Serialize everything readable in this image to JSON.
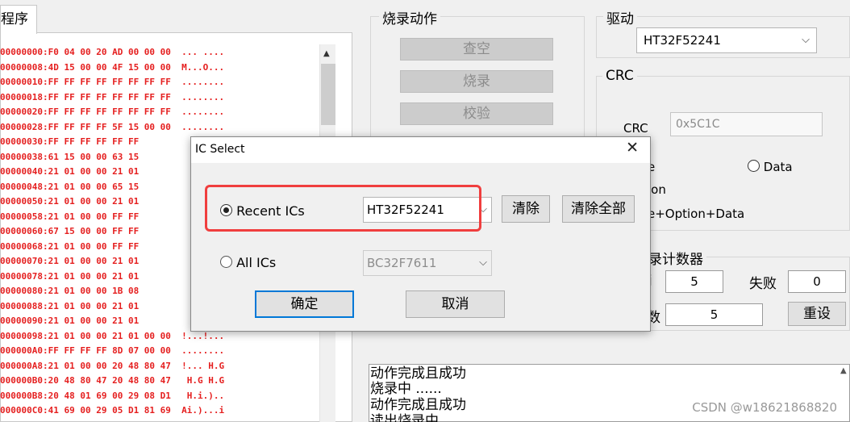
{
  "left_panel": {
    "tab_label": "程序",
    "hex_lines": [
      "00000000:F0 04 00 20 AD 00 00 00  ... ....",
      "00000008:4D 15 00 00 4F 15 00 00  M...O...",
      "00000010:FF FF FF FF FF FF FF FF  ........",
      "00000018:FF FF FF FF FF FF FF FF  ........",
      "00000020:FF FF FF FF FF FF FF FF  ........",
      "00000028:FF FF FF FF 5F 15 00 00  ........",
      "00000030:FF FF FF FF FF FF",
      "00000038:61 15 00 00 63 15",
      "00000040:21 01 00 00 21 01",
      "00000048:21 01 00 00 65 15",
      "00000050:21 01 00 00 21 01",
      "00000058:21 01 00 00 FF FF",
      "00000060:67 15 00 00 FF FF",
      "00000068:21 01 00 00 FF FF",
      "00000070:21 01 00 00 21 01",
      "00000078:21 01 00 00 21 01",
      "00000080:21 01 00 00 1B 08",
      "00000088:21 01 00 00 21 01",
      "00000090:21 01 00 00 21 01",
      "00000098:21 01 00 00 21 01 00 00  !...!...",
      "000000A0:FF FF FF FF 8D 07 00 00  ........",
      "000000A8:21 01 00 00 20 48 80 47  !... H.G",
      "000000B0:20 48 80 47 20 48 80 47   H.G H.G",
      "000000B8:20 48 01 69 00 29 08 D1   H.i.)..",
      "000000C0:41 69 00 29 05 D1 81 69  Ai.)...i"
    ]
  },
  "burn_actions": {
    "title": "烧录动作",
    "buttons": [
      "查空",
      "烧录",
      "校验"
    ]
  },
  "driver": {
    "title": "驱动",
    "selected": "HT32F52241"
  },
  "crc": {
    "title": "CRC",
    "label": "CRC",
    "value": "0x5C1C",
    "radio_data": "Data",
    "opt_partial_1": "e",
    "opt_partial_2": "ion",
    "opt_partial_3": "e+Option+Data"
  },
  "counter": {
    "title_partial": "录计数器",
    "success_label_partial": "j",
    "success_value": "5",
    "fail_label": "失败",
    "fail_value": "0",
    "total_label_partial": "数",
    "total_value": "5",
    "reset_label": "重设"
  },
  "log": {
    "lines": [
      "动作完成且成功",
      "烧录中 ......",
      "动作完成且成功",
      "读出烧录中"
    ]
  },
  "dialog": {
    "title": "IC Select",
    "close_glyph": "✕",
    "recent_label": "Recent ICs",
    "recent_value": "HT32F52241",
    "clear_label": "清除",
    "clear_all_label": "清除全部",
    "all_label": "All ICs",
    "all_value": "BC32F7611",
    "ok_label": "确定",
    "cancel_label": "取消"
  },
  "watermark": "CSDN @w18621868820",
  "colors": {
    "hex_text": "#e51f1f",
    "highlight": "#f03e3e",
    "default_border": "#0078d7"
  }
}
